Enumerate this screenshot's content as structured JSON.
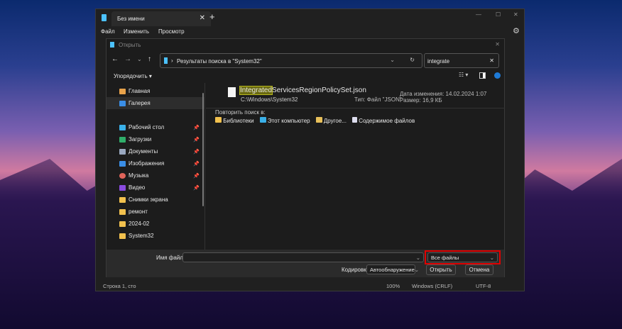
{
  "notepad": {
    "tab_title": "Без имени",
    "menu": [
      "Файл",
      "Изменить",
      "Просмотр"
    ],
    "status": {
      "position": "Строка 1, сто",
      "zoom": "100%",
      "line_ending": "Windows (CRLF)",
      "encoding": "UTF-8"
    }
  },
  "dialog": {
    "title": "Открыть",
    "address": "Результаты поиска в \"System32\"",
    "search_value": "integrate",
    "organize": "Упорядочить",
    "sidebar": [
      {
        "label": "Главная"
      },
      {
        "label": "Галерея"
      },
      {
        "label": "Рабочий стол",
        "pinned": true
      },
      {
        "label": "Загрузки",
        "pinned": true
      },
      {
        "label": "Документы",
        "pinned": true
      },
      {
        "label": "Изображения",
        "pinned": true
      },
      {
        "label": "Музыка",
        "pinned": true
      },
      {
        "label": "Видео",
        "pinned": true
      },
      {
        "label": "Снимки экрана"
      },
      {
        "label": "ремонт"
      },
      {
        "label": "2024-02"
      },
      {
        "label": "System32"
      }
    ],
    "result": {
      "name_highlight": "Integrated",
      "name_rest": "ServicesRegionPolicySet.json",
      "path": "C:\\Windows\\System32",
      "type": "Тип: Файл \"JSON\"",
      "modified": "Дата изменения: 14.02.2024 1:07",
      "size": "Размер: 16,9 КБ"
    },
    "repeat_label": "Повторить поиск в:",
    "repeat_options": [
      "Библиотеки",
      "Этот компьютер",
      "Другое...",
      "Содержимое файлов"
    ],
    "filename_label": "Имя файла:",
    "filename_value": "",
    "filetype": "Все файлы",
    "encoding_label": "Кодировка:",
    "encoding_value": "Автообнаружение",
    "open": "Открыть",
    "cancel": "Отмена"
  },
  "colors": {
    "highlight": "#e00000",
    "accent": "#4cc2ff"
  }
}
